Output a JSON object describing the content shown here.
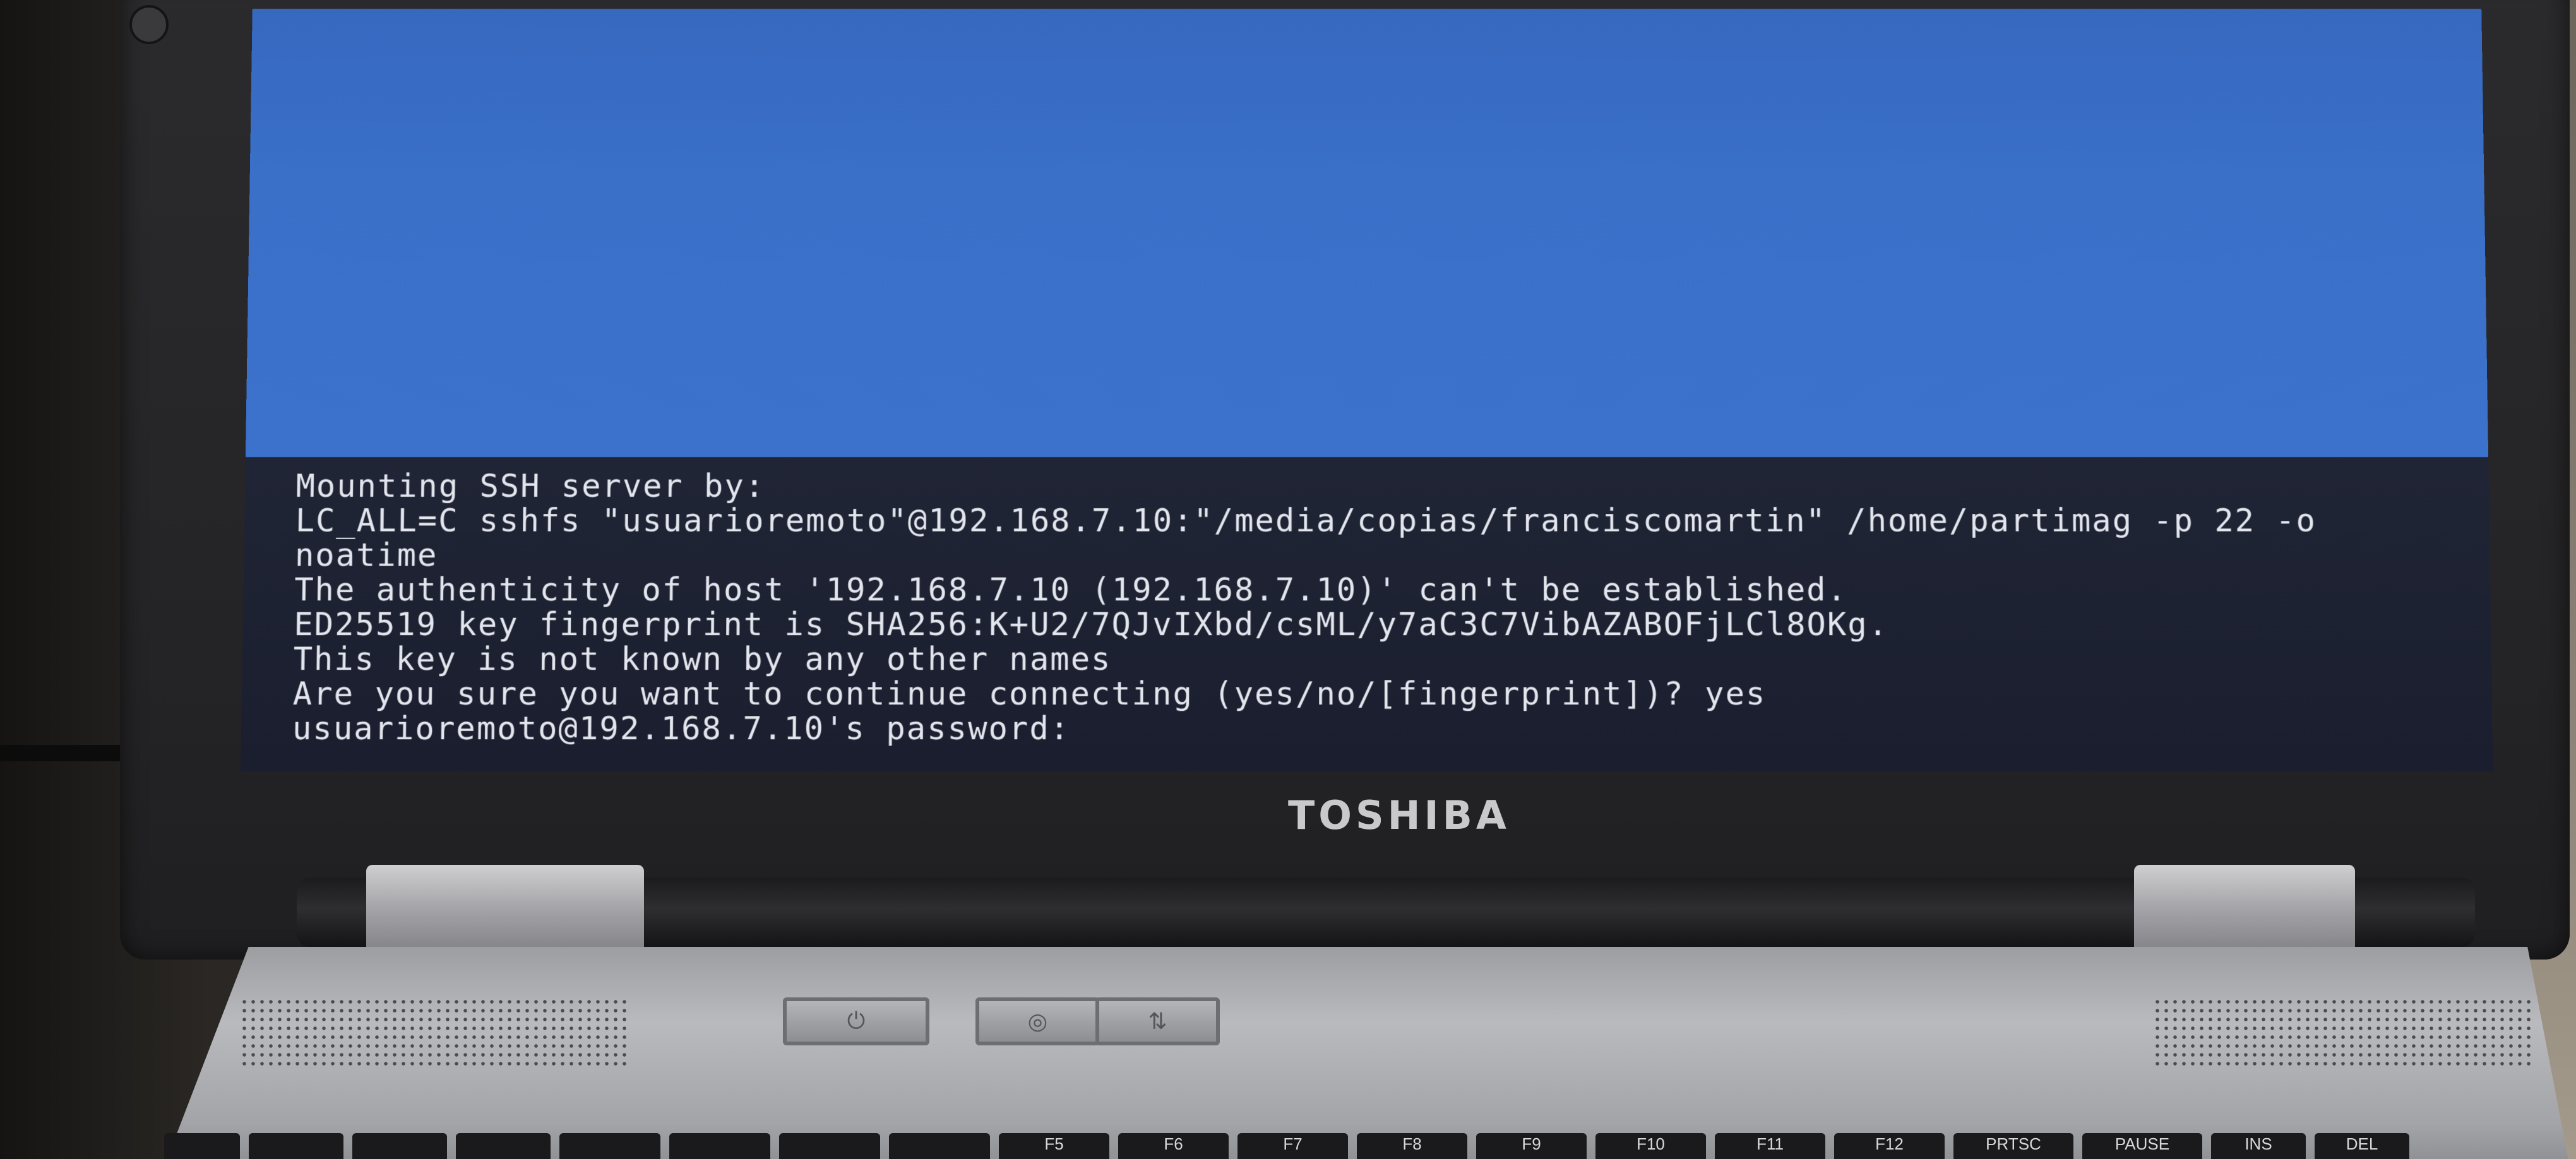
{
  "brand": "TOSHIBA",
  "console": {
    "lines": [
      "Mounting SSH server by:",
      "LC_ALL=C sshfs \"usuarioremoto\"@192.168.7.10:\"/media/copias/franciscomartin\" /home/partimag -p 22 -o",
      "noatime",
      "The authenticity of host '192.168.7.10 (192.168.7.10)' can't be established.",
      "ED25519 key fingerprint is SHA256:K+U2/7QJvIXbd/csML/y7aC3C7VibAZABOFjLCl8OKg.",
      "This key is not known by any other names",
      "Are you sure you want to continue connecting (yes/no/[fingerprint])? yes",
      "usuarioremoto@192.168.7.10's password:"
    ]
  },
  "keyboard": {
    "keys": [
      "F5",
      "F6",
      "F7",
      "F8",
      "F9",
      "F10",
      "F11",
      "F12",
      "PRTSC",
      "PAUSE",
      "INS",
      "DEL"
    ]
  },
  "icons": {
    "power": "power-icon",
    "lock": "lock-icon",
    "network": "network-icon"
  },
  "colors": {
    "desktop_blue": "#3a70c8",
    "console_bg": "#1c2132",
    "console_text": "#e4e6ee"
  }
}
